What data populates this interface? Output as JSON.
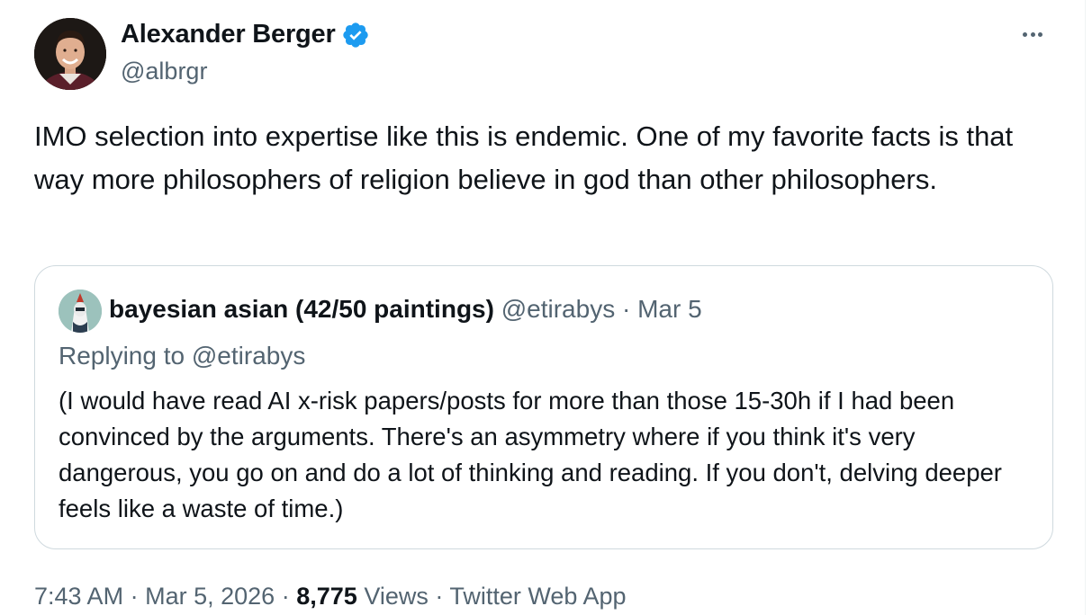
{
  "author": {
    "name": "Alexander Berger",
    "handle": "@albrgr"
  },
  "tweet_text": "IMO selection into expertise like this is endemic. One of my favorite facts is that way more philosophers of religion believe in god than other philosophers.",
  "quoted": {
    "name": "bayesian asian (42/50 paintings)",
    "handle": "@etirabys",
    "separator": "·",
    "date": "Mar 5",
    "replying_prefix": "Replying to",
    "replying_handle": "@etirabys",
    "text": "(I would have read AI x-risk papers/posts for more than those 15-30h if I had been convinced by the arguments. There's an asymmetry where if you think it's very dangerous, you go on and do a lot of thinking and reading. If you don't, delving deeper feels like a waste of time.)"
  },
  "footer": {
    "time": "7:43 AM",
    "sep1": "·",
    "date": "Mar 5, 2026",
    "sep2": "·",
    "views_count": "8,775",
    "views_label": "Views",
    "sep3": "·",
    "source": "Twitter Web App"
  },
  "colors": {
    "verified_blue": "#1d9bf0",
    "secondary_text": "#536471",
    "border": "#cfd9de"
  },
  "icons": {
    "verified": "verified-badge-icon",
    "more": "more-horizontal-icon"
  }
}
